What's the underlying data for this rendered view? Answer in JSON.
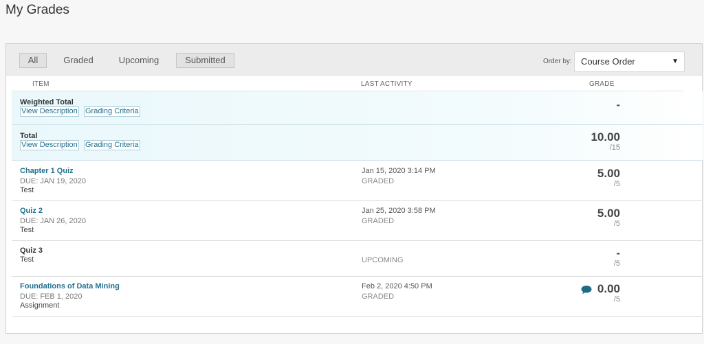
{
  "page": {
    "title": "My Grades"
  },
  "filters": {
    "all": "All",
    "graded": "Graded",
    "upcoming": "Upcoming",
    "submitted": "Submitted"
  },
  "order": {
    "label": "Order by:",
    "selected": "Course Order",
    "caret": "▼"
  },
  "columns": {
    "item": "ITEM",
    "last_activity": "LAST ACTIVITY",
    "grade": "GRADE"
  },
  "summary": [
    {
      "title": "Weighted Total",
      "view": "View Description",
      "criteria": "Grading Criteria",
      "grade": "-",
      "out_of": ""
    },
    {
      "title": "Total",
      "view": "View Description",
      "criteria": "Grading Criteria",
      "grade": "10.00",
      "out_of": "/15"
    }
  ],
  "items": [
    {
      "title": "Chapter 1 Quiz",
      "due": "DUE: JAN 19, 2020",
      "type": "Test",
      "activity": "Jan 15, 2020 3:14 PM",
      "status": "GRADED",
      "grade": "5.00",
      "out_of": "/5"
    },
    {
      "title": "Quiz 2",
      "due": "DUE: JAN 26, 2020",
      "type": "Test",
      "activity": "Jan 25, 2020 3:58 PM",
      "status": "GRADED",
      "grade": "5.00",
      "out_of": "/5"
    },
    {
      "title": "Quiz 3",
      "due": "",
      "type": "Test",
      "activity": "",
      "status": "UPCOMING",
      "grade": "-",
      "out_of": "/5"
    },
    {
      "title": "Foundations of Data Mining",
      "due": "DUE: FEB 1, 2020",
      "type": "Assignment",
      "activity": "Feb 2, 2020 4:50 PM",
      "status": "GRADED",
      "grade": "0.00",
      "out_of": "/5",
      "icon": "comment-icon"
    }
  ],
  "colors": {
    "accent": "#23718f",
    "highlight": "#eaf8fc",
    "comment_icon": "#1d6d86"
  }
}
